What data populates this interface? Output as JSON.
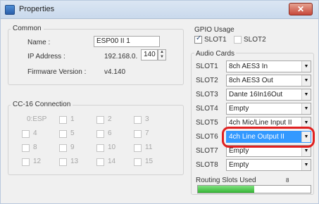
{
  "window": {
    "title": "Properties"
  },
  "common": {
    "label": "Common",
    "name_label": "Name :",
    "name_value": "ESP00 II 1",
    "ip_label": "IP Address :",
    "ip_prefix": "192.168.0.",
    "ip_last": "140",
    "fw_label": "Firmware Version :",
    "fw_value": "v4.140"
  },
  "cc16": {
    "label": "CC-16 Connection",
    "items": [
      "0:ESP",
      "1",
      "2",
      "3",
      "4",
      "5",
      "6",
      "7",
      "8",
      "9",
      "10",
      "11",
      "12",
      "13",
      "14",
      "15"
    ]
  },
  "gpio": {
    "label": "GPIO Usage",
    "slot1": {
      "label": "SLOT1",
      "checked": true
    },
    "slot2": {
      "label": "SLOT2",
      "checked": false
    }
  },
  "audio_cards": {
    "label": "Audio Cards",
    "slots": [
      {
        "label": "SLOT1",
        "value": "8ch AES3 In"
      },
      {
        "label": "SLOT2",
        "value": "8ch AES3 Out"
      },
      {
        "label": "SLOT3",
        "value": "Dante 16In16Out"
      },
      {
        "label": "SLOT4",
        "value": "Empty"
      },
      {
        "label": "SLOT5",
        "value": "4ch Mic/Line Input II"
      },
      {
        "label": "SLOT6",
        "value": "4ch Line Output II",
        "selected": true
      },
      {
        "label": "SLOT7",
        "value": "Empty"
      },
      {
        "label": "SLOT8",
        "value": "Empty"
      }
    ]
  },
  "routing": {
    "label": "Routing Slots Used",
    "count": "8",
    "fill_fraction": 0.5
  },
  "colors": {
    "highlight": "#e02020",
    "selected_bg": "#3399ff"
  }
}
